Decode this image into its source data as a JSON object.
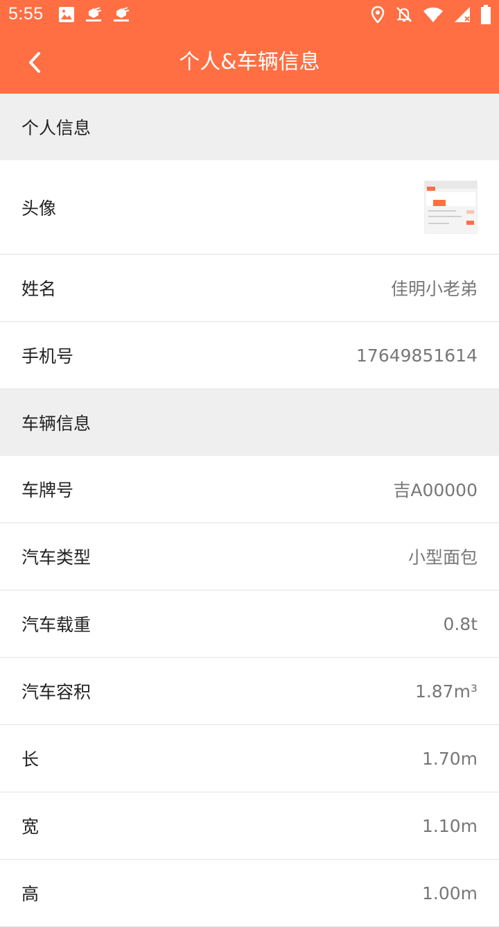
{
  "status_bar": {
    "time": "5:55",
    "left_icons": [
      "image-icon",
      "app-notification-icon",
      "app-notification-icon"
    ],
    "right_icons": [
      "location-icon",
      "notifications-off-icon",
      "wifi-icon",
      "signal-icon",
      "battery-icon"
    ]
  },
  "app_bar": {
    "title": "个人&车辆信息",
    "back_icon": "chevron-left-icon"
  },
  "personal_section": {
    "header": "个人信息",
    "avatar_label": "头像",
    "name_label": "姓名",
    "name_value": "佳明小老弟",
    "phone_label": "手机号",
    "phone_value": "17649851614"
  },
  "vehicle_section": {
    "header": "车辆信息",
    "rows": [
      {
        "label": "车牌号",
        "value": "吉A00000"
      },
      {
        "label": "汽车类型",
        "value": "小型面包"
      },
      {
        "label": "汽车载重",
        "value": "0.8t"
      },
      {
        "label": "汽车容积",
        "value": "1.87m³"
      },
      {
        "label": "长",
        "value": "1.70m"
      },
      {
        "label": "宽",
        "value": "1.10m"
      },
      {
        "label": "高",
        "value": "1.00m"
      }
    ]
  },
  "colors": {
    "primary": "#FF6F43",
    "section_bg": "#EFEFEF",
    "value_text": "#777777",
    "label_text": "#222222"
  }
}
